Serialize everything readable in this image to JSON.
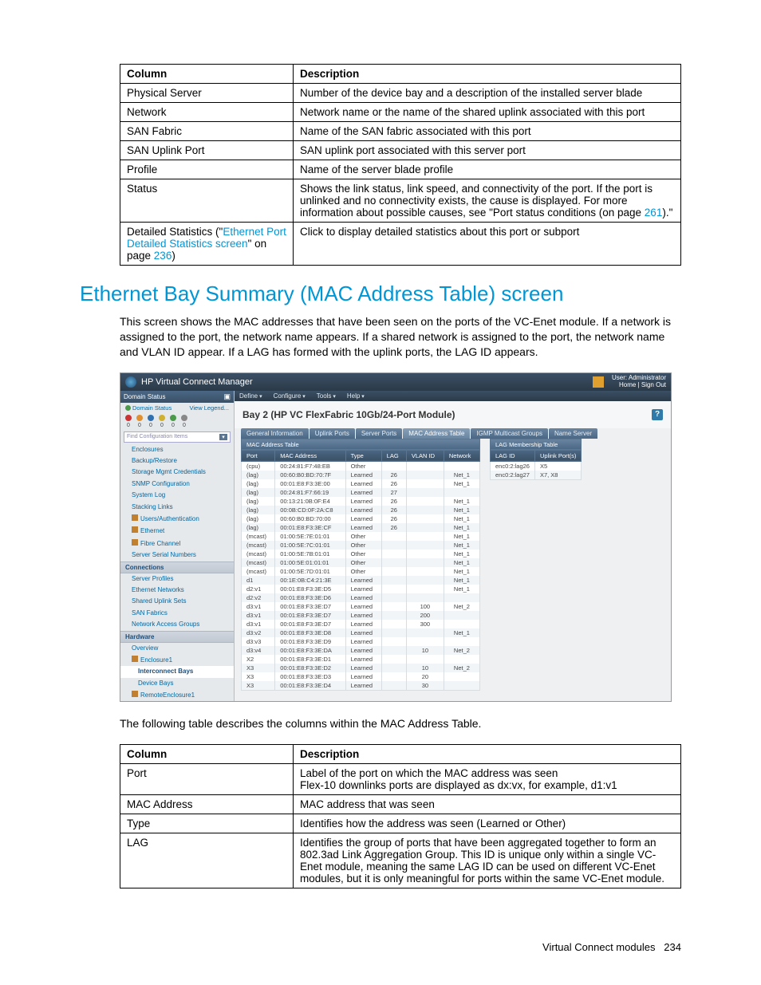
{
  "table1": {
    "headers": [
      "Column",
      "Description"
    ],
    "rows": [
      [
        "Physical Server",
        "Number of the device bay and a description of the installed server blade"
      ],
      [
        "Network",
        "Network name or the name of the shared uplink associated with this port"
      ],
      [
        "SAN Fabric",
        "Name of the SAN fabric associated with this port"
      ],
      [
        "SAN Uplink Port",
        "SAN uplink port associated with this server port"
      ],
      [
        "Profile",
        "Name of the server blade profile"
      ],
      [
        "Status",
        "Shows the link status, link speed, and connectivity of the port. If the port is unlinked and no connectivity exists, the cause is displayed. For more information about possible causes, see \"Port status conditions (on page "
      ],
      [
        "__detailed__",
        "Click to display detailed statistics about this port or subport"
      ]
    ],
    "status_link_text": "261",
    "status_suffix": ").\"",
    "detailed_prefix": "Detailed Statistics (\"",
    "detailed_link": "Ethernet Port Detailed Statistics screen",
    "detailed_mid": "\" on page ",
    "detailed_page": "236",
    "detailed_suffix": ")"
  },
  "section_title": "Ethernet Bay Summary (MAC Address Table) screen",
  "intro_para": "This screen shows the MAC addresses that have been seen on the ports of the VC-Enet module. If a network is assigned to the port, the network name appears. If a shared network is assigned to the port, the network name and VLAN ID appear. If a LAG has formed with the uplink ports, the LAG ID appears.",
  "app": {
    "title": "HP Virtual Connect Manager",
    "user_label": "User: Administrator",
    "links": "Home | Sign Out",
    "menubar": [
      "Define",
      "Configure",
      "Tools",
      "Help"
    ],
    "pane_title": "Bay 2 (HP VC FlexFabric 10Gb/24-Port Module)",
    "tabs": [
      "General Information",
      "Uplink Ports",
      "Server Ports",
      "MAC Address Table",
      "IGMP Multicast Groups",
      "Name Server"
    ],
    "active_tab": 3,
    "sidebar": {
      "domain_status_label": "Domain Status",
      "status_link": "Domain Status",
      "view_legend": "View Legend...",
      "refresh_icon": "↻",
      "status_nums": [
        "0",
        "0",
        "0",
        "0",
        "0",
        "0"
      ],
      "find_placeholder": "Find Configuration Items",
      "groups": [
        {
          "label": null,
          "items": [
            {
              "t": "Enclosures"
            },
            {
              "t": "Backup/Restore"
            },
            {
              "t": "Storage Mgmt Credentials"
            },
            {
              "t": "SNMP Configuration"
            },
            {
              "t": "System Log"
            },
            {
              "t": "Stacking Links"
            },
            {
              "t": "Users/Authentication",
              "folder": true
            },
            {
              "t": "Ethernet",
              "folder": true
            },
            {
              "t": "Fibre Channel",
              "folder": true
            },
            {
              "t": "Server Serial Numbers"
            }
          ]
        },
        {
          "label": "Connections",
          "items": [
            {
              "t": "Server Profiles"
            },
            {
              "t": "Ethernet Networks"
            },
            {
              "t": "Shared Uplink Sets"
            },
            {
              "t": "SAN Fabrics"
            },
            {
              "t": "Network Access Groups"
            }
          ]
        },
        {
          "label": "Hardware",
          "items": [
            {
              "t": "Overview"
            },
            {
              "t": "Enclosure1",
              "folder": true
            },
            {
              "t": "Interconnect Bays",
              "sel": true,
              "sub": true
            },
            {
              "t": "Device Bays",
              "sub": true
            },
            {
              "t": "RemoteEnclosure1",
              "folder": true
            }
          ]
        }
      ]
    },
    "mac_table": {
      "title": "MAC Address Table",
      "headers": [
        "Port",
        "MAC Address",
        "Type",
        "LAG",
        "VLAN ID",
        "Network"
      ],
      "rows": [
        [
          "(cpu)",
          "00:24:81:F7:48:EB",
          "Other",
          "",
          "",
          ""
        ],
        [
          "(lag)",
          "00:60:B0:BD:70:7F",
          "Learned",
          "26",
          "",
          "Net_1"
        ],
        [
          "(lag)",
          "00:01:E8:F3:3E:00",
          "Learned",
          "26",
          "",
          "Net_1"
        ],
        [
          "(lag)",
          "00:24:81:F7:66:19",
          "Learned",
          "27",
          "",
          ""
        ],
        [
          "(lag)",
          "00:13:21:0B:0F:E4",
          "Learned",
          "26",
          "",
          "Net_1"
        ],
        [
          "(lag)",
          "00:0B:CD:0F:2A:C8",
          "Learned",
          "26",
          "",
          "Net_1"
        ],
        [
          "(lag)",
          "00:60:B0:BD:70:00",
          "Learned",
          "26",
          "",
          "Net_1"
        ],
        [
          "(lag)",
          "00:01:E8:F3:3E:CF",
          "Learned",
          "26",
          "",
          "Net_1"
        ],
        [
          "(mcast)",
          "01:00:5E:7E:01:01",
          "Other",
          "",
          "",
          "Net_1"
        ],
        [
          "(mcast)",
          "01:00:5E:7C:01:01",
          "Other",
          "",
          "",
          "Net_1"
        ],
        [
          "(mcast)",
          "01:00:5E:7B:01:01",
          "Other",
          "",
          "",
          "Net_1"
        ],
        [
          "(mcast)",
          "01:00:5E:01:01:01",
          "Other",
          "",
          "",
          "Net_1"
        ],
        [
          "(mcast)",
          "01:00:5E:7D:01:01",
          "Other",
          "",
          "",
          "Net_1"
        ],
        [
          "d1",
          "00:1E:0B:C4:21:3E",
          "Learned",
          "",
          "",
          "Net_1"
        ],
        [
          "d2:v1",
          "00:01:E8:F3:3E:D5",
          "Learned",
          "",
          "",
          "Net_1"
        ],
        [
          "d2:v2",
          "00:01:E8:F3:3E:D6",
          "Learned",
          "",
          "",
          ""
        ],
        [
          "d3:v1",
          "00:01:E8:F3:3E:D7",
          "Learned",
          "",
          "100",
          "Net_2"
        ],
        [
          "d3:v1",
          "00:01:E8:F3:3E:D7",
          "Learned",
          "",
          "200",
          ""
        ],
        [
          "d3:v1",
          "00:01:E8:F3:3E:D7",
          "Learned",
          "",
          "300",
          ""
        ],
        [
          "d3:v2",
          "00:01:E8:F3:3E:D8",
          "Learned",
          "",
          "",
          "Net_1"
        ],
        [
          "d3:v3",
          "00:01:E8:F3:3E:D9",
          "Learned",
          "",
          "",
          ""
        ],
        [
          "d3:v4",
          "00:01:E8:F3:3E:DA",
          "Learned",
          "",
          "10",
          "Net_2"
        ],
        [
          "X2",
          "00:01:E8:F3:3E:D1",
          "Learned",
          "",
          "",
          ""
        ],
        [
          "X3",
          "00:01:E8:F3:3E:D2",
          "Learned",
          "",
          "10",
          "Net_2"
        ],
        [
          "X3",
          "00:01:E8:F3:3E:D3",
          "Learned",
          "",
          "20",
          ""
        ],
        [
          "X3",
          "00:01:E8:F3:3E:D4",
          "Learned",
          "",
          "30",
          ""
        ]
      ]
    },
    "lag_table": {
      "title": "LAG Membership Table",
      "headers": [
        "LAG ID",
        "Uplink Port(s)"
      ],
      "rows": [
        [
          "enc0:2:lag26",
          "X5"
        ],
        [
          "enc0:2:lag27",
          "X7, X8"
        ]
      ]
    }
  },
  "intro_para2": "The following table describes the columns within the MAC Address Table.",
  "table2": {
    "headers": [
      "Column",
      "Description"
    ],
    "rows": [
      [
        "Port",
        "Label of the port on which the MAC address was seen\nFlex-10 downlinks ports are displayed as dx:vx, for example, d1:v1"
      ],
      [
        "MAC Address",
        "MAC address that was seen"
      ],
      [
        "Type",
        "Identifies how the address was seen (Learned or Other)"
      ],
      [
        "LAG",
        "Identifies the group of ports that have been aggregated together to form an 802.3ad Link Aggregation Group. This ID is unique only within a single VC-Enet module, meaning the same LAG ID can be used on different VC-Enet modules, but it is only meaningful for ports within the same VC-Enet module."
      ]
    ]
  },
  "footer": {
    "text": "Virtual Connect modules",
    "page": "234"
  }
}
